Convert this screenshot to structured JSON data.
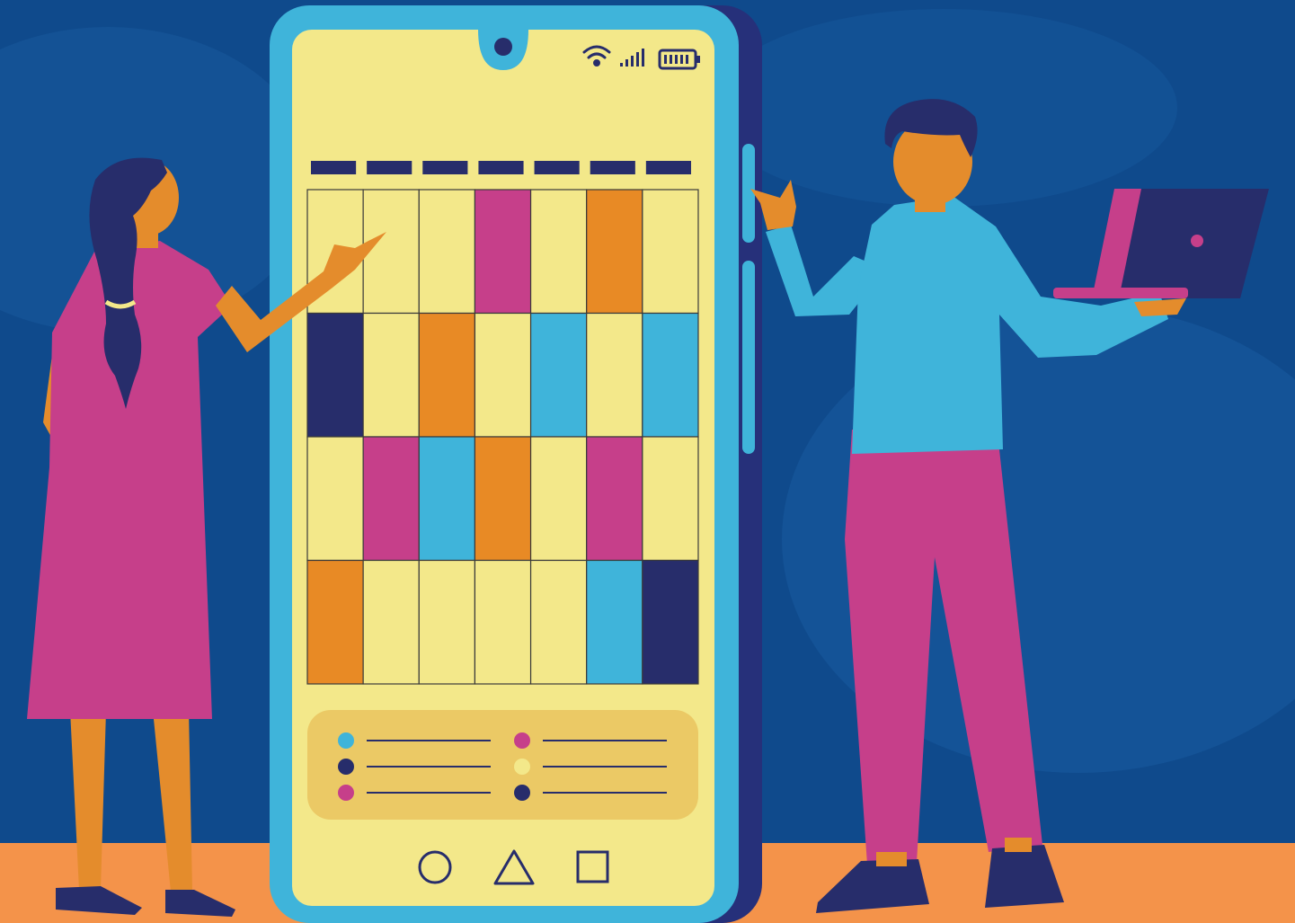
{
  "palette": {
    "background": "#0f4a8c",
    "background_light": "#1b5fa3",
    "floor": "#f4934a",
    "phone_frame": "#3fb4da",
    "phone_side": "#26307a",
    "screen": "#f3e88a",
    "navy": "#272d6b",
    "pink": "#c63f8a",
    "orange": "#e88a25",
    "cyan": "#3fb4da",
    "legend_bg": "#ebc965",
    "skin": "#e48c2c"
  },
  "calendar": {
    "header_bar_count": 7,
    "rows": [
      [
        "screen",
        "screen",
        "screen",
        "pink",
        "screen",
        "orange",
        "screen"
      ],
      [
        "navy",
        "screen",
        "orange",
        "screen",
        "cyan",
        "screen",
        "cyan"
      ],
      [
        "screen",
        "pink",
        "cyan",
        "orange",
        "screen",
        "pink",
        "screen"
      ],
      [
        "orange",
        "screen",
        "screen",
        "screen",
        "screen",
        "cyan",
        "navy"
      ]
    ]
  },
  "legend": {
    "left": [
      "cyan",
      "navy",
      "pink"
    ],
    "right": [
      "pink",
      "screen",
      "navy"
    ]
  },
  "icons": {
    "status": [
      "wifi-icon",
      "signal-icon",
      "battery-icon"
    ],
    "nav": [
      "home-circle-icon",
      "back-triangle-icon",
      "recents-square-icon"
    ]
  }
}
